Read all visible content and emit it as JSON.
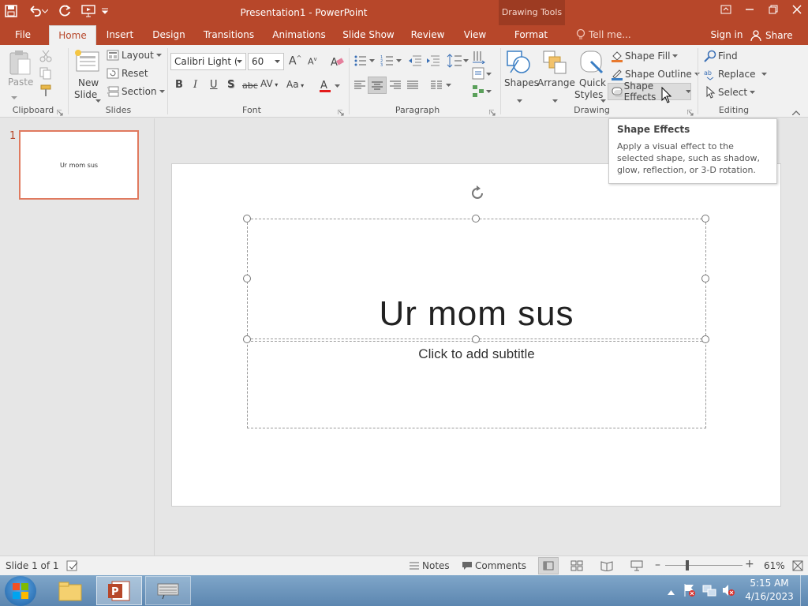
{
  "window": {
    "title": "Presentation1 - PowerPoint",
    "context_tab_group": "Drawing Tools",
    "sign_in": "Sign in",
    "share": "Share",
    "tell_me": "Tell me..."
  },
  "tabs": [
    "File",
    "Home",
    "Insert",
    "Design",
    "Transitions",
    "Animations",
    "Slide Show",
    "Review",
    "View",
    "Format"
  ],
  "ribbon": {
    "clipboard": {
      "label": "Clipboard",
      "paste": "Paste"
    },
    "slides": {
      "label": "Slides",
      "new_slide_1": "New",
      "new_slide_2": "Slide",
      "layout": "Layout",
      "reset": "Reset",
      "section": "Section"
    },
    "font": {
      "label": "Font",
      "font_name": "Calibri Light (H",
      "font_size": "60"
    },
    "paragraph": {
      "label": "Paragraph"
    },
    "drawing": {
      "label": "Drawing",
      "shapes": "Shapes",
      "arrange": "Arrange",
      "quick_1": "Quick",
      "quick_2": "Styles",
      "shape_fill": "Shape Fill",
      "shape_outline": "Shape Outline",
      "shape_effects": "Shape Effects"
    },
    "editing": {
      "label": "Editing",
      "find": "Find",
      "replace": "Replace",
      "select": "Select"
    }
  },
  "tooltip": {
    "title": "Shape Effects",
    "body": "Apply a visual effect to the selected shape, such as shadow, glow, reflection, or 3-D rotation."
  },
  "thumbnail": {
    "number": "1",
    "text": "Ur mom sus"
  },
  "slide": {
    "title": "Ur mom sus",
    "subtitle_placeholder": "Click to add subtitle"
  },
  "status": {
    "slide_info": "Slide 1 of 1",
    "notes": "Notes",
    "comments": "Comments",
    "zoom": "61%"
  },
  "taskbar": {
    "time": "5:15 AM",
    "date": "4/16/2023"
  },
  "colors": {
    "accent": "#b7472a",
    "ribbon_bg": "#f1f1f1",
    "font_color_bar": "#e31b1b"
  }
}
